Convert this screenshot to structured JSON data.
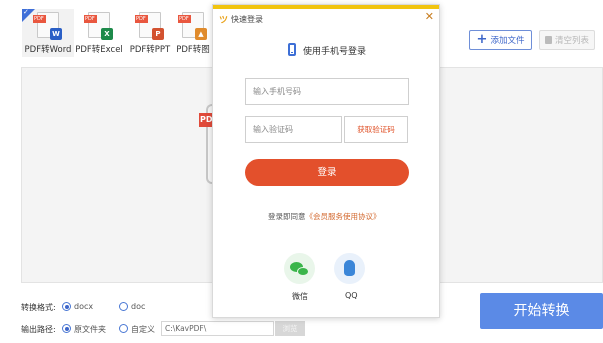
{
  "toolbar": {
    "tabs": [
      {
        "label": "PDF转Word",
        "tag": "PDF",
        "doc": "W",
        "doc_color": "#2b5fc6"
      },
      {
        "label": "PDF转Excel",
        "tag": "PDF",
        "doc": "X",
        "doc_color": "#1d8a4a"
      },
      {
        "label": "PDF转PPT",
        "tag": "PDF",
        "doc": "P",
        "doc_color": "#d35230"
      },
      {
        "label": "PDF转图",
        "tag": "PDF",
        "doc": "▲",
        "doc_color": "#e08b2c"
      }
    ],
    "add_file_label": "添加文件",
    "clear_list_label": "清空列表"
  },
  "file_area": {
    "pdf_mark": "PDF"
  },
  "settings": {
    "format_label": "转换格式:",
    "format_options": [
      "docx",
      "doc"
    ],
    "format_selected": "docx",
    "output_label": "输出路径:",
    "output_options": [
      "原文件夹",
      "自定义"
    ],
    "output_selected": "原文件夹",
    "path_value": "C:\\KavPDF\\",
    "browse_label": "浏览"
  },
  "start_button_label": "开始转换",
  "login_modal": {
    "title": "快速登录",
    "close_glyph": "✕",
    "subtitle": "使用手机号登录",
    "phone_placeholder": "输入手机号码",
    "code_placeholder": "输入验证码",
    "get_code_label": "获取验证码",
    "login_label": "登录",
    "agreement_prefix": "登录即同意",
    "agreement_link": "《会员服务使用协议》",
    "wechat_label": "微信",
    "qq_label": "QQ"
  },
  "colors": {
    "accent_blue": "#3d66c9",
    "login_orange": "#e3502c",
    "start_blue": "#5b8ae6"
  }
}
